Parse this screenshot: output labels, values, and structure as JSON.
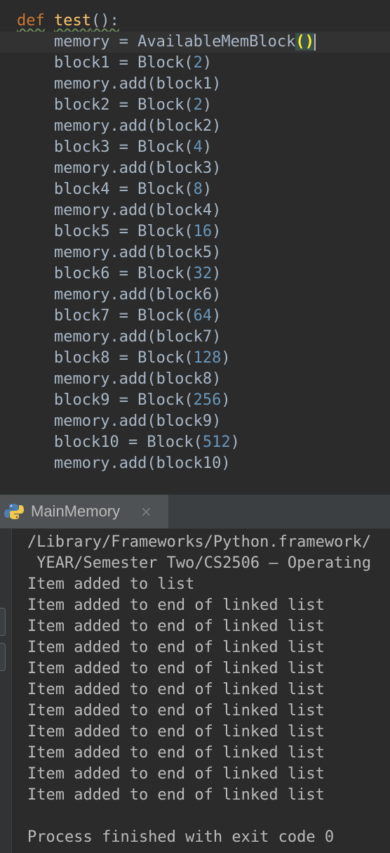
{
  "editor": {
    "def_keyword": "def",
    "func_name": "test",
    "func_sig_tail": "():",
    "lines": [
      "    memory = AvailableMemBlock",
      "    block1 = Block(",
      "2",
      ")",
      "    memory.add(block1)",
      "    block2 = Block(",
      "2",
      ")",
      "    memory.add(block2)",
      "    block3 = Block(",
      "4",
      ")",
      "    memory.add(block3)",
      "    block4 = Block(",
      "8",
      ")",
      "    memory.add(block4)",
      "    block5 = Block(",
      "16",
      ")",
      "    memory.add(block5)",
      "    block6 = Block(",
      "32",
      ")",
      "    memory.add(block6)",
      "    block7 = Block(",
      "64",
      ")",
      "    memory.add(block7)",
      "    block8 = Block(",
      "128",
      ")",
      "    memory.add(block8)",
      "    block9 = Block(",
      "256",
      ")",
      "    memory.add(block9)",
      "    block10 = Block(",
      "512",
      ")",
      "    memory.add(block10)"
    ],
    "memory_line_prefix": "    memory = AvailableMemBlock",
    "memory_line_parens": "()",
    "code_rows": [
      {
        "pre": "    block1 = Block(",
        "num": "2",
        "post": ")"
      },
      {
        "pre": "    memory.add(block1)",
        "num": "",
        "post": ""
      },
      {
        "pre": "    block2 = Block(",
        "num": "2",
        "post": ")"
      },
      {
        "pre": "    memory.add(block2)",
        "num": "",
        "post": ""
      },
      {
        "pre": "    block3 = Block(",
        "num": "4",
        "post": ")"
      },
      {
        "pre": "    memory.add(block3)",
        "num": "",
        "post": ""
      },
      {
        "pre": "    block4 = Block(",
        "num": "8",
        "post": ")"
      },
      {
        "pre": "    memory.add(block4)",
        "num": "",
        "post": ""
      },
      {
        "pre": "    block5 = Block(",
        "num": "16",
        "post": ")"
      },
      {
        "pre": "    memory.add(block5)",
        "num": "",
        "post": ""
      },
      {
        "pre": "    block6 = Block(",
        "num": "32",
        "post": ")"
      },
      {
        "pre": "    memory.add(block6)",
        "num": "",
        "post": ""
      },
      {
        "pre": "    block7 = Block(",
        "num": "64",
        "post": ")"
      },
      {
        "pre": "    memory.add(block7)",
        "num": "",
        "post": ""
      },
      {
        "pre": "    block8 = Block(",
        "num": "128",
        "post": ")"
      },
      {
        "pre": "    memory.add(block8)",
        "num": "",
        "post": ""
      },
      {
        "pre": "    block9 = Block(",
        "num": "256",
        "post": ")"
      },
      {
        "pre": "    memory.add(block9)",
        "num": "",
        "post": ""
      },
      {
        "pre": "    block10 = Block(",
        "num": "512",
        "post": ")"
      },
      {
        "pre": "    memory.add(block10)",
        "num": "",
        "post": ""
      }
    ]
  },
  "run_panel": {
    "tab_label": "MainMemory",
    "tab_close": "×",
    "tab_icon": "python-icon",
    "console_lines": [
      "/Library/Frameworks/Python.framework/",
      " YEAR/Semester Two/CS2506 – Operating",
      "Item added to list",
      "Item added to end of linked list",
      "Item added to end of linked list",
      "Item added to end of linked list",
      "Item added to end of linked list",
      "Item added to end of linked list",
      "Item added to end of linked list",
      "Item added to end of linked list",
      "Item added to end of linked list",
      "Item added to end of linked list",
      "Item added to end of linked list",
      "",
      "Process finished with exit code 0"
    ]
  },
  "colors": {
    "background": "#2b2b2b",
    "keyword": "#cc7832",
    "function": "#ffc66d",
    "number": "#6897bb",
    "text": "#a9b7c6"
  }
}
